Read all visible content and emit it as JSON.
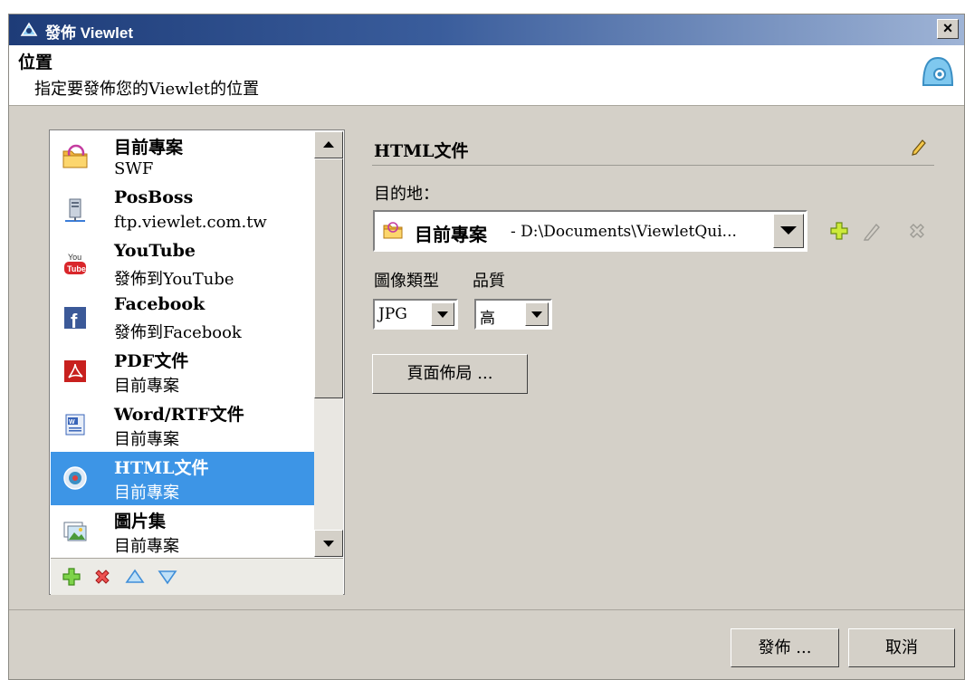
{
  "window": {
    "title": "發佈 Viewlet",
    "close_label": "×"
  },
  "header": {
    "title": "位置",
    "subtitle": "指定要發佈您的Viewlet的位置"
  },
  "publish_targets": [
    {
      "name": "目前專案",
      "detail": "SWF",
      "icon": "folder-icon"
    },
    {
      "name": "PosBoss",
      "detail": "ftp.viewlet.com.tw",
      "icon": "ftp-server-icon"
    },
    {
      "name": "YouTube",
      "detail": "發佈到YouTube",
      "icon": "youtube-icon"
    },
    {
      "name": "Facebook",
      "detail": "發佈到Facebook",
      "icon": "facebook-icon"
    },
    {
      "name": "PDF文件",
      "detail": "目前專案",
      "icon": "pdf-icon"
    },
    {
      "name": "Word/RTF文件",
      "detail": "目前專案",
      "icon": "word-icon"
    },
    {
      "name": "HTML文件",
      "detail": "目前專案",
      "icon": "html-icon",
      "selected": true
    },
    {
      "name": "圖片集",
      "detail": "目前專案",
      "icon": "image-gallery-icon"
    }
  ],
  "panel": {
    "title": "HTML文件",
    "destination_label": "目的地：",
    "destination_name": "目前專案",
    "destination_path": "- D:\\Documents\\ViewletQui...",
    "image_type_label": "圖像類型",
    "image_type_value": "JPG",
    "quality_label": "品質",
    "quality_value": "高",
    "page_layout_label": "頁面佈局 ..."
  },
  "footer": {
    "publish_label": "發佈 ...",
    "cancel_label": "取消"
  },
  "colors": {
    "selection": "#3d95e6",
    "window_bg": "#d4d0c8",
    "titlebar": "#1e3c78",
    "add_green": "#4caf1e",
    "delete_red": "#d9262b",
    "arrow_blue": "#3f8ed8"
  }
}
